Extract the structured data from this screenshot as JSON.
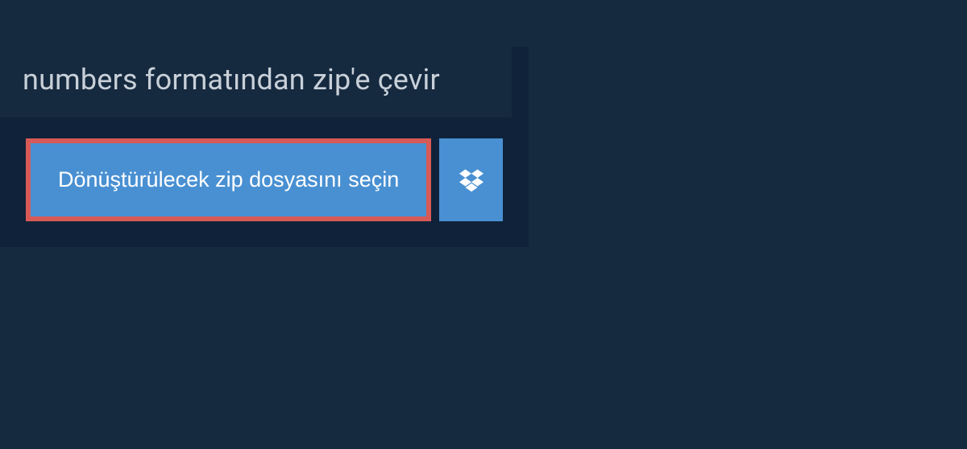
{
  "header": {
    "title": "numbers formatından zip'e çevir"
  },
  "actions": {
    "file_select_label": "Dönüştürülecek zip dosyasını seçin"
  }
}
